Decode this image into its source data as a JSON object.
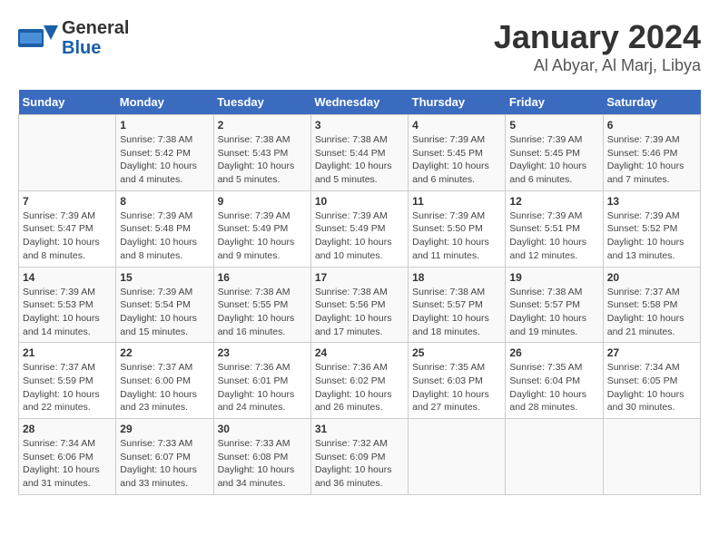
{
  "header": {
    "logo_line1": "General",
    "logo_line2": "Blue",
    "title": "January 2024",
    "subtitle": "Al Abyar, Al Marj, Libya"
  },
  "weekdays": [
    "Sunday",
    "Monday",
    "Tuesday",
    "Wednesday",
    "Thursday",
    "Friday",
    "Saturday"
  ],
  "weeks": [
    [
      {
        "day": "",
        "info": ""
      },
      {
        "day": "1",
        "info": "Sunrise: 7:38 AM\nSunset: 5:42 PM\nDaylight: 10 hours\nand 4 minutes."
      },
      {
        "day": "2",
        "info": "Sunrise: 7:38 AM\nSunset: 5:43 PM\nDaylight: 10 hours\nand 5 minutes."
      },
      {
        "day": "3",
        "info": "Sunrise: 7:38 AM\nSunset: 5:44 PM\nDaylight: 10 hours\nand 5 minutes."
      },
      {
        "day": "4",
        "info": "Sunrise: 7:39 AM\nSunset: 5:45 PM\nDaylight: 10 hours\nand 6 minutes."
      },
      {
        "day": "5",
        "info": "Sunrise: 7:39 AM\nSunset: 5:45 PM\nDaylight: 10 hours\nand 6 minutes."
      },
      {
        "day": "6",
        "info": "Sunrise: 7:39 AM\nSunset: 5:46 PM\nDaylight: 10 hours\nand 7 minutes."
      }
    ],
    [
      {
        "day": "7",
        "info": "Sunrise: 7:39 AM\nSunset: 5:47 PM\nDaylight: 10 hours\nand 8 minutes."
      },
      {
        "day": "8",
        "info": "Sunrise: 7:39 AM\nSunset: 5:48 PM\nDaylight: 10 hours\nand 8 minutes."
      },
      {
        "day": "9",
        "info": "Sunrise: 7:39 AM\nSunset: 5:49 PM\nDaylight: 10 hours\nand 9 minutes."
      },
      {
        "day": "10",
        "info": "Sunrise: 7:39 AM\nSunset: 5:49 PM\nDaylight: 10 hours\nand 10 minutes."
      },
      {
        "day": "11",
        "info": "Sunrise: 7:39 AM\nSunset: 5:50 PM\nDaylight: 10 hours\nand 11 minutes."
      },
      {
        "day": "12",
        "info": "Sunrise: 7:39 AM\nSunset: 5:51 PM\nDaylight: 10 hours\nand 12 minutes."
      },
      {
        "day": "13",
        "info": "Sunrise: 7:39 AM\nSunset: 5:52 PM\nDaylight: 10 hours\nand 13 minutes."
      }
    ],
    [
      {
        "day": "14",
        "info": "Sunrise: 7:39 AM\nSunset: 5:53 PM\nDaylight: 10 hours\nand 14 minutes."
      },
      {
        "day": "15",
        "info": "Sunrise: 7:39 AM\nSunset: 5:54 PM\nDaylight: 10 hours\nand 15 minutes."
      },
      {
        "day": "16",
        "info": "Sunrise: 7:38 AM\nSunset: 5:55 PM\nDaylight: 10 hours\nand 16 minutes."
      },
      {
        "day": "17",
        "info": "Sunrise: 7:38 AM\nSunset: 5:56 PM\nDaylight: 10 hours\nand 17 minutes."
      },
      {
        "day": "18",
        "info": "Sunrise: 7:38 AM\nSunset: 5:57 PM\nDaylight: 10 hours\nand 18 minutes."
      },
      {
        "day": "19",
        "info": "Sunrise: 7:38 AM\nSunset: 5:57 PM\nDaylight: 10 hours\nand 19 minutes."
      },
      {
        "day": "20",
        "info": "Sunrise: 7:37 AM\nSunset: 5:58 PM\nDaylight: 10 hours\nand 21 minutes."
      }
    ],
    [
      {
        "day": "21",
        "info": "Sunrise: 7:37 AM\nSunset: 5:59 PM\nDaylight: 10 hours\nand 22 minutes."
      },
      {
        "day": "22",
        "info": "Sunrise: 7:37 AM\nSunset: 6:00 PM\nDaylight: 10 hours\nand 23 minutes."
      },
      {
        "day": "23",
        "info": "Sunrise: 7:36 AM\nSunset: 6:01 PM\nDaylight: 10 hours\nand 24 minutes."
      },
      {
        "day": "24",
        "info": "Sunrise: 7:36 AM\nSunset: 6:02 PM\nDaylight: 10 hours\nand 26 minutes."
      },
      {
        "day": "25",
        "info": "Sunrise: 7:35 AM\nSunset: 6:03 PM\nDaylight: 10 hours\nand 27 minutes."
      },
      {
        "day": "26",
        "info": "Sunrise: 7:35 AM\nSunset: 6:04 PM\nDaylight: 10 hours\nand 28 minutes."
      },
      {
        "day": "27",
        "info": "Sunrise: 7:34 AM\nSunset: 6:05 PM\nDaylight: 10 hours\nand 30 minutes."
      }
    ],
    [
      {
        "day": "28",
        "info": "Sunrise: 7:34 AM\nSunset: 6:06 PM\nDaylight: 10 hours\nand 31 minutes."
      },
      {
        "day": "29",
        "info": "Sunrise: 7:33 AM\nSunset: 6:07 PM\nDaylight: 10 hours\nand 33 minutes."
      },
      {
        "day": "30",
        "info": "Sunrise: 7:33 AM\nSunset: 6:08 PM\nDaylight: 10 hours\nand 34 minutes."
      },
      {
        "day": "31",
        "info": "Sunrise: 7:32 AM\nSunset: 6:09 PM\nDaylight: 10 hours\nand 36 minutes."
      },
      {
        "day": "",
        "info": ""
      },
      {
        "day": "",
        "info": ""
      },
      {
        "day": "",
        "info": ""
      }
    ]
  ]
}
